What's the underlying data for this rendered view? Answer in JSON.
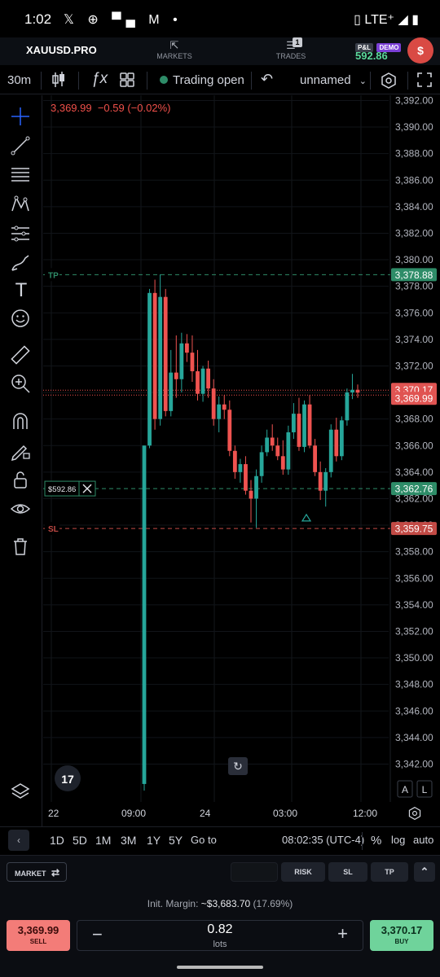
{
  "status_bar": {
    "time": "1:02",
    "icons": "𝕏 ⊕ ▀▄ M •",
    "network": "▯ LTE⁺ ◢ ▮"
  },
  "header": {
    "symbol": "XAUUSD.PRO",
    "markets_label": "MARKETS",
    "trades_label": "TRADES",
    "trades_count": "1",
    "pnl_label": "P&L",
    "demo_label": "DEMO",
    "pnl_value": "592.86",
    "avatar_letter": "$"
  },
  "toolbar": {
    "interval": "30m",
    "trading_status": "Trading open",
    "layout_name": "unnamed"
  },
  "chart_info": {
    "ohlc_price": "3,369.99",
    "ohlc_change": "−0.59 (−0.02%)"
  },
  "chart_data": {
    "type": "candlestick",
    "ylim": [
      3340.8,
      3392.2
    ],
    "y_ticks": [
      "3,392.00",
      "3,390.00",
      "3,388.00",
      "3,386.00",
      "3,384.00",
      "3,382.00",
      "3,380.00",
      "3,378.00",
      "3,376.00",
      "3,374.00",
      "3,372.00",
      "3,370.00",
      "3,368.00",
      "3,366.00",
      "3,364.00",
      "3,362.00",
      "3,360.00",
      "3,358.00",
      "3,356.00",
      "3,354.00",
      "3,352.00",
      "3,350.00",
      "3,348.00",
      "3,346.00",
      "3,344.00",
      "3,342.00"
    ],
    "x_ticks": [
      "22",
      "09:00",
      "24",
      "03:00",
      "12:00"
    ],
    "lines": [
      {
        "label": "TP",
        "price": 3378.88,
        "price_label": "3,378.88",
        "color": "#2e8c68"
      },
      {
        "label": "$592.86",
        "price": 3362.76,
        "price_label": "3,362.76",
        "color": "#2e8c68"
      },
      {
        "label": "SL",
        "price": 3359.75,
        "price_label": "3,359.75",
        "color": "#c24a45"
      }
    ],
    "current_price_labels": [
      "3,370.17",
      "3,369.99"
    ],
    "current_ask": 3370.17,
    "current_bid": 3369.99,
    "candles": [
      [
        3340.5,
        3366.0,
        3340.0,
        3366.0
      ],
      [
        3366.0,
        3377.8,
        3365.8,
        3377.5
      ],
      [
        3377.5,
        3378.5,
        3367.2,
        3368.0
      ],
      [
        3368.0,
        3378.9,
        3367.5,
        3377.2
      ],
      [
        3377.2,
        3377.8,
        3368.2,
        3368.6
      ],
      [
        3368.6,
        3373.2,
        3368.2,
        3371.5
      ],
      [
        3371.5,
        3374.3,
        3369.6,
        3371.0
      ],
      [
        3371.0,
        3374.5,
        3370.0,
        3373.7
      ],
      [
        3373.7,
        3374.4,
        3372.3,
        3373.0
      ],
      [
        3373.0,
        3374.3,
        3370.8,
        3371.6
      ],
      [
        3371.6,
        3373.2,
        3369.4,
        3369.9
      ],
      [
        3369.9,
        3372.0,
        3369.3,
        3371.8
      ],
      [
        3371.8,
        3372.4,
        3369.6,
        3370.3
      ],
      [
        3370.3,
        3371.0,
        3367.5,
        3368.0
      ],
      [
        3368.0,
        3369.7,
        3367.0,
        3369.1
      ],
      [
        3369.1,
        3369.8,
        3368.0,
        3368.7
      ],
      [
        3368.7,
        3369.4,
        3365.2,
        3365.6
      ],
      [
        3365.6,
        3366.0,
        3363.5,
        3364.0
      ],
      [
        3364.0,
        3365.0,
        3363.2,
        3364.6
      ],
      [
        3364.6,
        3365.2,
        3362.3,
        3362.6
      ],
      [
        3362.6,
        3363.4,
        3360.2,
        3362.0
      ],
      [
        3362.0,
        3364.2,
        3359.8,
        3363.7
      ],
      [
        3363.7,
        3366.0,
        3363.2,
        3365.5
      ],
      [
        3365.5,
        3367.2,
        3365.2,
        3366.6
      ],
      [
        3366.6,
        3367.6,
        3365.6,
        3366.0
      ],
      [
        3366.0,
        3366.6,
        3364.9,
        3365.2
      ],
      [
        3365.2,
        3366.4,
        3363.8,
        3364.2
      ],
      [
        3364.2,
        3367.5,
        3363.8,
        3367.0
      ],
      [
        3367.0,
        3369.2,
        3366.5,
        3368.4
      ],
      [
        3368.4,
        3369.6,
        3365.6,
        3365.9
      ],
      [
        3365.9,
        3369.4,
        3365.5,
        3369.1
      ],
      [
        3369.1,
        3369.8,
        3365.8,
        3366.0
      ],
      [
        3366.0,
        3366.5,
        3363.7,
        3364.0
      ],
      [
        3364.0,
        3364.8,
        3361.9,
        3362.6
      ],
      [
        3362.6,
        3364.3,
        3361.4,
        3364.0
      ],
      [
        3364.0,
        3367.6,
        3363.6,
        3367.2
      ],
      [
        3367.2,
        3368.1,
        3364.8,
        3365.2
      ],
      [
        3365.2,
        3368.2,
        3364.9,
        3367.9
      ],
      [
        3367.9,
        3370.3,
        3367.5,
        3370.0
      ],
      [
        3370.0,
        3371.4,
        3369.5,
        3370.2
      ],
      [
        3370.2,
        3370.6,
        3369.6,
        3369.99
      ]
    ]
  },
  "position": {
    "pl_label": "$592.86"
  },
  "range_bar": {
    "ranges": [
      "1D",
      "5D",
      "1M",
      "3M",
      "1Y",
      "5Y"
    ],
    "goto": "Go to",
    "clock": "08:02:35 (UTC-4)",
    "percent": "%",
    "log": "log",
    "auto": "auto"
  },
  "order_bar": {
    "market_label": "MARKET",
    "risk_label": "RISK",
    "sl_label": "SL",
    "tp_label": "TP"
  },
  "trade": {
    "margin_label": "Init. Margin:",
    "margin_value": "~$3,683.70",
    "margin_pct": "(17.69%)",
    "sell_price": "3,369.99",
    "sell_label": "SELL",
    "buy_price": "3,370.17",
    "buy_label": "BUY",
    "lots": "0.82",
    "lots_unit": "lots"
  },
  "colors": {
    "up": "#26a69a",
    "down": "#ef5350",
    "accent": "#2962ff",
    "tp": "#2e8c68",
    "sl": "#c24a45",
    "sell": "#f37c78",
    "buy": "#6fd39b"
  }
}
